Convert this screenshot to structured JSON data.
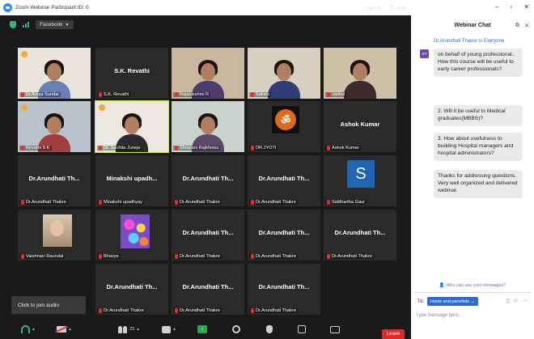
{
  "window_title": "Zoom Webinar Participant ID: 0",
  "top_toolbar": {
    "facebook_label": "Facebook",
    "sign_in": "Sign in",
    "view": "View"
  },
  "tiles": [
    {
      "name": "Dr.Anoja Sundar",
      "big": "",
      "kind": "photo",
      "bg": "#e9e4dc",
      "body": "#6a7fb5",
      "logo": true
    },
    {
      "name": "S.K. Revathi",
      "big": "S.K. Revathi",
      "kind": "name"
    },
    {
      "name": "Rajalakshmi R",
      "big": "",
      "kind": "photo",
      "bg": "#c8b8a0",
      "body": "#4b3b6e"
    },
    {
      "name": "Sakshi",
      "big": "",
      "kind": "photo",
      "bg": "#d9cfc0",
      "body": "#2d3f76"
    },
    {
      "name": "Janhvi",
      "big": "",
      "kind": "photo",
      "bg": "#cfc0a8",
      "body": "#3e2c2c"
    },
    {
      "name": "Revathi S K",
      "big": "",
      "kind": "photo",
      "bg": "#b9c3cc",
      "body": "#a03d3d",
      "logo": true
    },
    {
      "name": "Dr. Sachita Juneja",
      "big": "",
      "kind": "photo",
      "bg": "#ebe8e2",
      "body": "#2b2b2b",
      "active": true,
      "logo": true
    },
    {
      "name": "Shravani Rajkhowa",
      "big": "",
      "kind": "photo",
      "bg": "#c9d2cc",
      "body": "#5b4a6e"
    },
    {
      "name": "DR.JYOTI",
      "big": "",
      "kind": "jyoti"
    },
    {
      "name": "Ashok Kumar",
      "big": "Ashok Kumar",
      "kind": "name"
    },
    {
      "name": "Dr.Arundhati Thakre",
      "big": "Dr.Arundhati Th...",
      "kind": "name"
    },
    {
      "name": "Minakshi upadhyay",
      "big": "Minakshi upadh...",
      "kind": "name"
    },
    {
      "name": "Dr.Arundhati Thakre",
      "big": "Dr.Arundhati Th...",
      "kind": "name"
    },
    {
      "name": "Dr.Arundhati Thakre",
      "big": "Dr.Arundhati Th...",
      "kind": "name"
    },
    {
      "name": "Siddhartha Gaur",
      "big": "",
      "kind": "s",
      "letter": "S"
    },
    {
      "name": "Vaishnavi Raundal",
      "big": "",
      "kind": "child"
    },
    {
      "name": "Bhavya",
      "big": "",
      "kind": "flower"
    },
    {
      "name": "Dr.Arundhati Thakre",
      "big": "Dr.Arundhati Th...",
      "kind": "name"
    },
    {
      "name": "Dr.Arundhati Thakre",
      "big": "Dr.Arundhati Th...",
      "kind": "name"
    },
    {
      "name": "Dr.Arundhati Thakre",
      "big": "Dr.Arundhati Th...",
      "kind": "name"
    },
    {
      "name": "",
      "big": "",
      "kind": "empty"
    },
    {
      "name": "Dr.Arundhati Thakre",
      "big": "Dr.Arundhati Th...",
      "kind": "name"
    },
    {
      "name": "Dr.Arundhati Thakre",
      "big": "Dr.Arundhati Th...",
      "kind": "name"
    },
    {
      "name": "Dr.Arundhati Thakre",
      "big": "Dr.Arundhati Th...",
      "kind": "name"
    }
  ],
  "tooltip": "Click to join audio",
  "bottom_toolbar": {
    "participants_count": "23",
    "leave": "Leave"
  },
  "chat": {
    "title": "Webinar Chat",
    "sender": "Dr.Arundhati Thakre",
    "to_word": "to",
    "audience": "Everyone",
    "avatar_initials": "DT",
    "messages": [
      "on behalf of young professional.. How this course will be useful to early career professionals?",
      "2. Will it be useful to Medical graduates(MBBS)?",
      "3. How about usefulness to budding Hospital managers and hospital administrators?",
      "Thanks for addressing questions. Very well organized and delivered webinar."
    ],
    "who_sees": "Who can see your messages?",
    "to_label": "To:",
    "to_value": "Hosts and panelists",
    "input_placeholder": "Type message here..."
  },
  "colors": {
    "accent_blue": "#2d6bcf",
    "leave_red": "#e02828",
    "active_outline": "#c7e04b",
    "mute_red": "#e03030"
  }
}
